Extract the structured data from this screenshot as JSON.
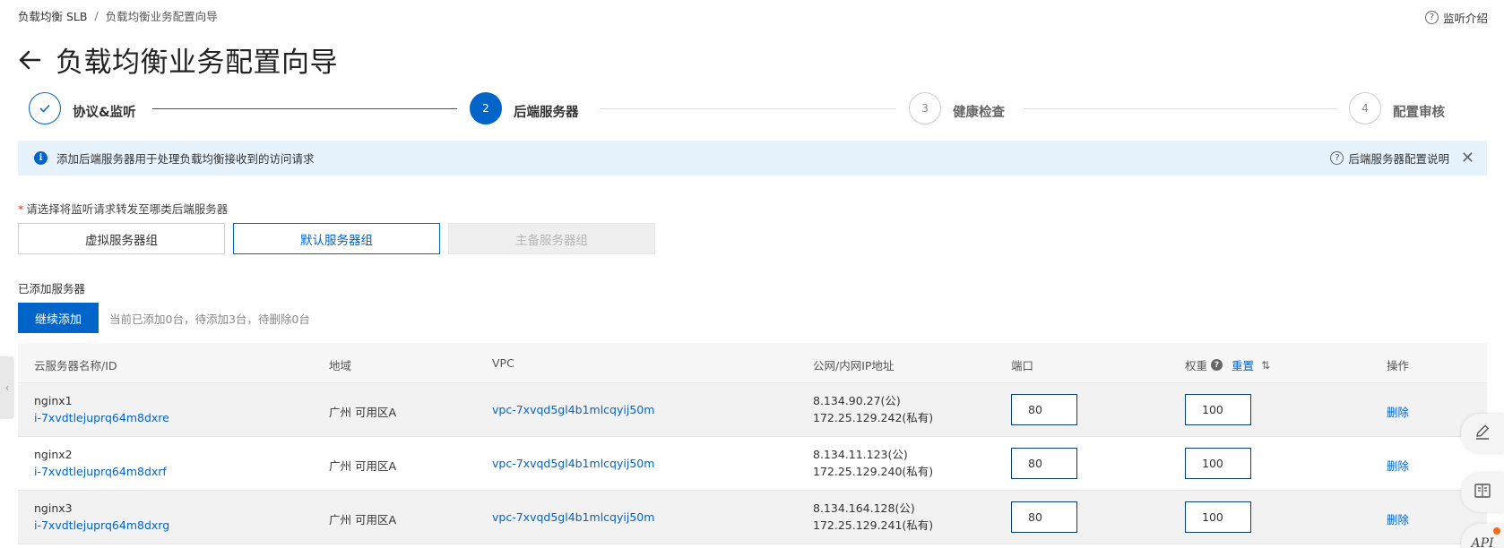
{
  "breadcrumb": {
    "root": "负载均衡 SLB",
    "separator": "/",
    "current": "负载均衡业务配置向导"
  },
  "header": {
    "help_label": "监听介绍",
    "title": "负载均衡业务配置向导"
  },
  "steps": [
    {
      "label": "协议&监听",
      "state": "done",
      "marker": "✓"
    },
    {
      "label": "后端服务器",
      "state": "active",
      "marker": "2"
    },
    {
      "label": "健康检查",
      "state": "todo",
      "marker": "3"
    },
    {
      "label": "配置审核",
      "state": "todo",
      "marker": "4"
    }
  ],
  "banner": {
    "text": "添加后端服务器用于处理负载均衡接收到的访问请求",
    "help_link": "后端服务器配置说明"
  },
  "server_type": {
    "required_mark": "*",
    "prompt": "请选择将监听请求转发至哪类后端服务器",
    "options": [
      {
        "label": "虚拟服务器组",
        "state": "normal"
      },
      {
        "label": "默认服务器组",
        "state": "selected"
      },
      {
        "label": "主备服务器组",
        "state": "disabled"
      }
    ]
  },
  "added_servers": {
    "label": "已添加服务器",
    "add_button": "继续添加",
    "status": "当前已添加0台，待添加3台，待删除0台"
  },
  "table": {
    "columns": {
      "name": "云服务器名称/ID",
      "region": "地域",
      "vpc": "VPC",
      "ip": "公网/内网IP地址",
      "port": "端口",
      "weight": "权重",
      "weight_reset": "重置",
      "action": "操作"
    },
    "rows": [
      {
        "name": "nginx1",
        "id": "i-7xvdtlejuprq64m8dxre",
        "region": "广州 可用区A",
        "vpc": "vpc-7xvqd5gl4b1mlcqyij50m",
        "public_ip": "8.134.90.27(公)",
        "private_ip": "172.25.129.242(私有)",
        "port": "80",
        "weight": "100",
        "action": "删除"
      },
      {
        "name": "nginx2",
        "id": "i-7xvdtlejuprq64m8dxrf",
        "region": "广州 可用区A",
        "vpc": "vpc-7xvqd5gl4b1mlcqyij50m",
        "public_ip": "8.134.11.123(公)",
        "private_ip": "172.25.129.240(私有)",
        "port": "80",
        "weight": "100",
        "action": "删除"
      },
      {
        "name": "nginx3",
        "id": "i-7xvdtlejuprq64m8dxrg",
        "region": "广州 可用区A",
        "vpc": "vpc-7xvqd5gl4b1mlcqyij50m",
        "public_ip": "8.134.164.128(公)",
        "private_ip": "172.25.129.241(私有)",
        "port": "80",
        "weight": "100",
        "action": "删除"
      }
    ]
  },
  "floating_tools": {
    "api_label": "API"
  },
  "colors": {
    "primary": "#0064c8",
    "banner_bg": "#e6f3fd",
    "notification_dot": "#f26b1d"
  }
}
